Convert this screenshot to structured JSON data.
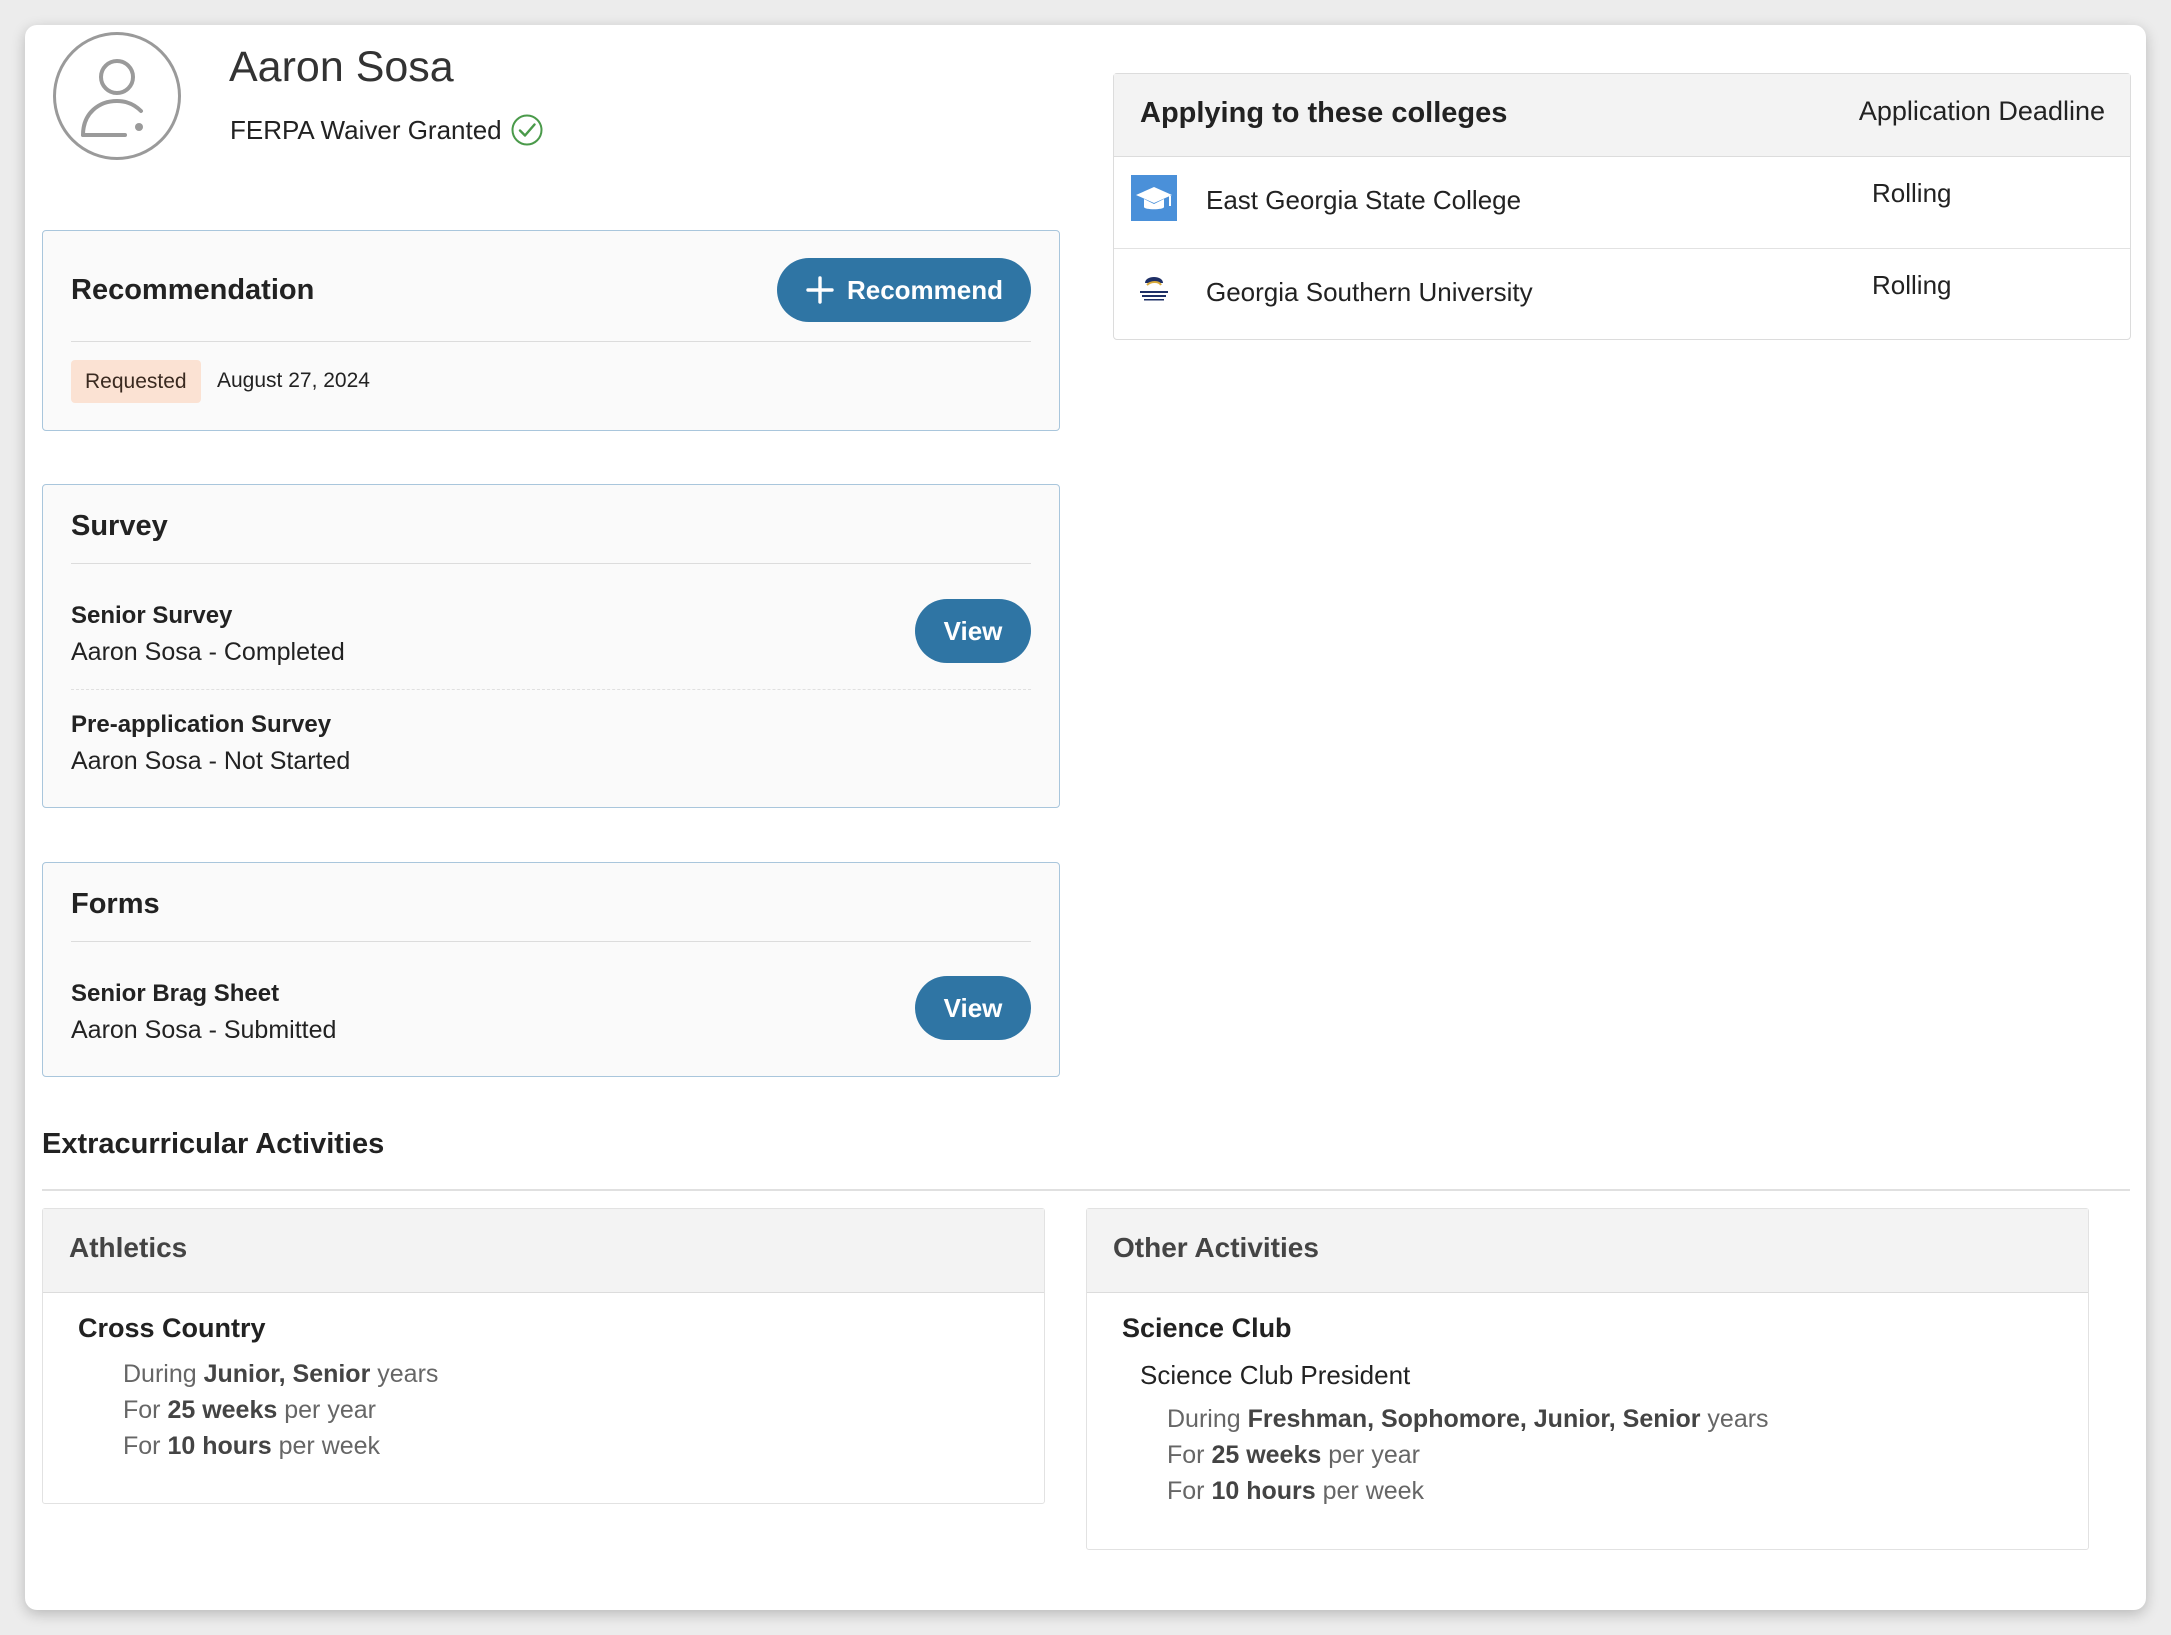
{
  "student": {
    "name": "Aaron Sosa",
    "ferpa": "FERPA Waiver Granted"
  },
  "recommendation": {
    "title": "Recommendation",
    "button_label": "Recommend",
    "status": "Requested",
    "date": "August 27, 2024"
  },
  "survey": {
    "title": "Survey",
    "items": [
      {
        "title": "Senior Survey",
        "subtitle": "Aaron Sosa - Completed",
        "button": "View"
      },
      {
        "title": "Pre-application Survey",
        "subtitle": "Aaron Sosa - Not Started"
      }
    ]
  },
  "forms": {
    "title": "Forms",
    "items": [
      {
        "title": "Senior Brag Sheet",
        "subtitle": "Aaron Sosa - Submitted",
        "button": "View"
      }
    ]
  },
  "colleges": {
    "title": "Applying to these colleges",
    "deadline_header": "Application Deadline",
    "rows": [
      {
        "name": "East Georgia State College",
        "deadline": "Rolling",
        "icon": "graduation-cap-icon"
      },
      {
        "name": "Georgia Southern University",
        "deadline": "Rolling",
        "icon": "university-logo-icon"
      }
    ]
  },
  "extracurricular": {
    "title": "Extracurricular Activities",
    "athletics": {
      "title": "Athletics",
      "activity": "Cross Country",
      "during_prefix": "During",
      "during_years": "Junior, Senior",
      "during_suffix": "years",
      "weeks_prefix": "For",
      "weeks": "25 weeks",
      "weeks_suffix": "per year",
      "hours_prefix": "For",
      "hours": "10 hours",
      "hours_suffix": "per week"
    },
    "other": {
      "title": "Other Activities",
      "activity": "Science Club",
      "role": "Science Club President",
      "during_prefix": "During",
      "during_years": "Freshman, Sophomore, Junior, Senior",
      "during_suffix": "years",
      "weeks_prefix": "For",
      "weeks": "25 weeks",
      "weeks_suffix": "per year",
      "hours_prefix": "For",
      "hours": "10 hours",
      "hours_suffix": "per week"
    }
  },
  "colors": {
    "primary_button": "#2f75a4",
    "panel_border": "#a9c6dc",
    "requested_badge": "#fbe2d3",
    "ferpa_check": "#3f8f3f"
  }
}
